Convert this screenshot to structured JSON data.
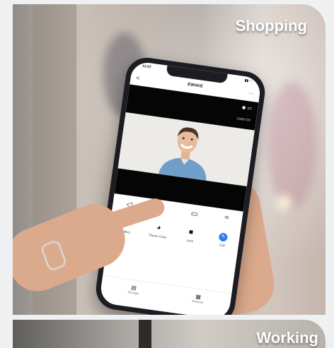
{
  "cards": [
    {
      "title": "Shopping"
    },
    {
      "title": "Working"
    }
  ],
  "phone": {
    "status": {
      "time": "12:07",
      "signal": ""
    },
    "nav": {
      "back": "<",
      "title": "EWAKE",
      "more": "···"
    },
    "video": {
      "resolution": "1280x720"
    },
    "actions": [
      {
        "label": "Gallery",
        "icon": "gallery-icon"
      },
      {
        "label": "Theme Color",
        "icon": "palette-icon"
      },
      {
        "label": "Lock",
        "icon": "lock-icon"
      },
      {
        "label": "Call",
        "icon": "call-icon"
      }
    ],
    "tabs": [
      {
        "label": "Storage",
        "icon": "storage-icon"
      },
      {
        "label": "Devices",
        "icon": "grid-icon"
      }
    ]
  },
  "colors": {
    "accent": "#2b7de9",
    "title_text": "#ffffff",
    "screen_black": "#050505"
  }
}
